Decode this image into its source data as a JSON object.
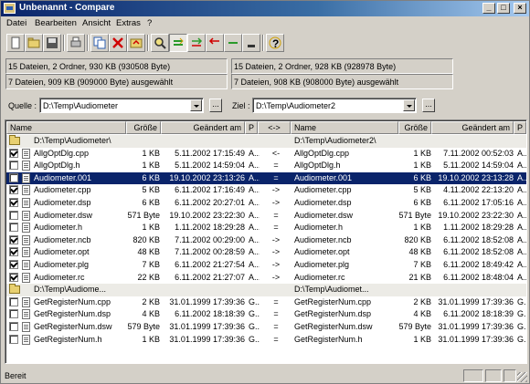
{
  "window": {
    "title": "Unbenannt - Compare"
  },
  "menu": [
    "Datei",
    "Bearbeiten",
    "Ansicht",
    "Extras",
    "?"
  ],
  "toolbar": {
    "icons": [
      "new-icon",
      "open-icon",
      "save-icon",
      "print-icon",
      "copy-files-icon",
      "delete-icon",
      "refresh-icon",
      "find-icon",
      "compare-equal-icon",
      "copy-right-icon",
      "copy-left-icon",
      "filter-icon",
      "help-icon"
    ]
  },
  "info": {
    "left_line1": "15 Dateien, 2 Ordner, 930 KB (930508 Byte)",
    "left_line2": "7 Dateien, 909 KB (909000 Byte) ausgewählt",
    "right_line1": "15 Dateien, 2 Ordner, 928 KB (928978 Byte)",
    "right_line2": "7 Dateien, 908 KB (908000 Byte) ausgewählt"
  },
  "source": {
    "label": "Quelle :",
    "value": "D:\\Temp\\Audiometer",
    "browse": "..."
  },
  "target": {
    "label": "Ziel :",
    "value": "D:\\Temp\\Audiometer2",
    "browse": "..."
  },
  "columns": {
    "name": "Name",
    "size": "Größe",
    "changed": "Geändert am",
    "p": "P",
    "dir": "<->",
    "name2": "Name",
    "size2": "Größe",
    "changed2": "Geändert am",
    "p2": "P"
  },
  "rows": [
    {
      "type": "group",
      "left": "D:\\Temp\\Audiometer\\",
      "right": "D:\\Temp\\Audiometer2\\"
    },
    {
      "check": true,
      "name": "AllgOptDlg.cpp",
      "size": "1 KB",
      "date": "5.11.2002 17:15:49",
      "p": "A...",
      "dir": "<-",
      "name2": "AllgOptDlg.cpp",
      "size2": "1 KB",
      "date2": "7.11.2002 00:52:03",
      "p2": "A..."
    },
    {
      "check": false,
      "name": "AllgOptDlg.h",
      "size": "1 KB",
      "date": "5.11.2002 14:59:04",
      "p": "A...",
      "dir": "=",
      "name2": "AllgOptDlg.h",
      "size2": "1 KB",
      "date2": "5.11.2002 14:59:04",
      "p2": "A..."
    },
    {
      "check": false,
      "selected": true,
      "name": "Audiometer.001",
      "size": "6 KB",
      "date": "19.10.2002 23:13:26",
      "p": "A...",
      "dir": "=",
      "name2": "Audiometer.001",
      "size2": "6 KB",
      "date2": "19.10.2002 23:13:28",
      "p2": "A..."
    },
    {
      "check": true,
      "name": "Audiometer.cpp",
      "size": "5 KB",
      "date": "6.11.2002 17:16:49",
      "p": "A...",
      "dir": "->",
      "name2": "Audiometer.cpp",
      "size2": "5 KB",
      "date2": "4.11.2002 22:13:20",
      "p2": "A..."
    },
    {
      "check": true,
      "name": "Audiometer.dsp",
      "size": "6 KB",
      "date": "6.11.2002 20:27:01",
      "p": "A...",
      "dir": "->",
      "name2": "Audiometer.dsp",
      "size2": "6 KB",
      "date2": "6.11.2002 17:05:16",
      "p2": "A..."
    },
    {
      "check": false,
      "name": "Audiometer.dsw",
      "size": "571 Byte",
      "date": "19.10.2002 23:22:30",
      "p": "A...",
      "dir": "=",
      "name2": "Audiometer.dsw",
      "size2": "571 Byte",
      "date2": "19.10.2002 23:22:30",
      "p2": "A..."
    },
    {
      "check": false,
      "name": "Audiometer.h",
      "size": "1 KB",
      "date": "1.11.2002 18:29:28",
      "p": "A...",
      "dir": "=",
      "name2": "Audiometer.h",
      "size2": "1 KB",
      "date2": "1.11.2002 18:29:28",
      "p2": "A..."
    },
    {
      "check": true,
      "name": "Audiometer.ncb",
      "size": "820 KB",
      "date": "7.11.2002 00:29:00",
      "p": "A...",
      "dir": "->",
      "name2": "Audiometer.ncb",
      "size2": "820 KB",
      "date2": "6.11.2002 18:52:08",
      "p2": "A..."
    },
    {
      "check": true,
      "name": "Audiometer.opt",
      "size": "48 KB",
      "date": "7.11.2002 00:28:59",
      "p": "A...",
      "dir": "->",
      "name2": "Audiometer.opt",
      "size2": "48 KB",
      "date2": "6.11.2002 18:52:08",
      "p2": "A..."
    },
    {
      "check": true,
      "name": "Audiometer.plg",
      "size": "7 KB",
      "date": "6.11.2002 21:27:54",
      "p": "A...",
      "dir": "->",
      "name2": "Audiometer.plg",
      "size2": "7 KB",
      "date2": "6.11.2002 18:49:42",
      "p2": "A..."
    },
    {
      "check": true,
      "name": "Audiometer.rc",
      "size": "22 KB",
      "date": "6.11.2002 21:27:07",
      "p": "A...",
      "dir": "->",
      "name2": "Audiometer.rc",
      "size2": "21 KB",
      "date2": "6.11.2002 18:48:04",
      "p2": "A..."
    },
    {
      "type": "group",
      "left": "D:\\Temp\\Audiome...",
      "right": "D:\\Temp\\Audiomet..."
    },
    {
      "check": false,
      "name": "GetRegisterNum.cpp",
      "size": "2 KB",
      "date": "31.01.1999 17:39:36",
      "p": "G...",
      "dir": "=",
      "name2": "GetRegisterNum.cpp",
      "size2": "2 KB",
      "date2": "31.01.1999 17:39:36",
      "p2": "G..."
    },
    {
      "check": false,
      "name": "GetRegisterNum.dsp",
      "size": "4 KB",
      "date": "6.11.2002 18:18:39",
      "p": "G...",
      "dir": "=",
      "name2": "GetRegisterNum.dsp",
      "size2": "4 KB",
      "date2": "6.11.2002 18:18:39",
      "p2": "G..."
    },
    {
      "check": false,
      "name": "GetRegisterNum.dsw",
      "size": "579 Byte",
      "date": "31.01.1999 17:39:36",
      "p": "G...",
      "dir": "=",
      "name2": "GetRegisterNum.dsw",
      "size2": "579 Byte",
      "date2": "31.01.1999 17:39:36",
      "p2": "G..."
    },
    {
      "check": false,
      "name": "GetRegisterNum.h",
      "size": "1 KB",
      "date": "31.01.1999 17:39:36",
      "p": "G...",
      "dir": "=",
      "name2": "GetRegisterNum.h",
      "size2": "1 KB",
      "date2": "31.01.1999 17:39:36",
      "p2": "G..."
    }
  ],
  "status": {
    "text": "Bereit"
  },
  "colors": {
    "titlebar": "#0a246a",
    "selection": "#0a246a",
    "face": "#d4d0c8"
  }
}
